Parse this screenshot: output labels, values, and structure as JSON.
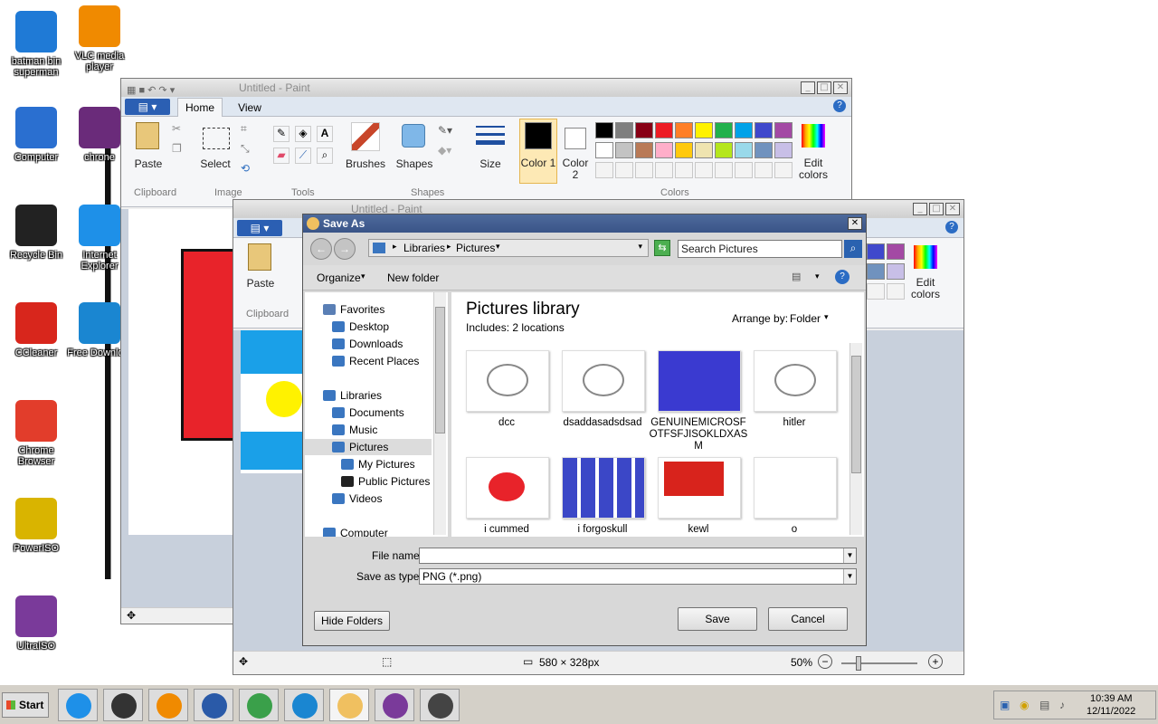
{
  "desktop": {
    "icons": [
      {
        "label": "batman bin superman",
        "color": "#1f7ad6"
      },
      {
        "label": "VLC media player",
        "color": "#f08a00"
      },
      {
        "label": "Computer",
        "color": "#2a6fd0"
      },
      {
        "label": "chrone",
        "color": "#6a2b7a"
      },
      {
        "label": "Recycle Bin",
        "color": "#222222"
      },
      {
        "label": "Internet Explorer",
        "color": "#1e90e8"
      },
      {
        "label": "CCleaner",
        "color": "#d8261c"
      },
      {
        "label": "Free Downlo...",
        "color": "#1a86d1"
      },
      {
        "label": "Chrome Browser",
        "color": "#e23d2b"
      },
      {
        "label": "PowerISO",
        "color": "#d9b400"
      },
      {
        "label": "UltraISO",
        "color": "#7a3a9a"
      }
    ]
  },
  "paint_back": {
    "title": "Untitled - Paint",
    "tabs": [
      "Home",
      "View"
    ],
    "clipboard": {
      "paste": "Paste",
      "group": "Clipboard"
    },
    "image": {
      "select": "Select",
      "group": "Image"
    },
    "tools_group": "Tools",
    "brushes": "Brushes",
    "shapes": {
      "label": "Shapes",
      "group": "Shapes"
    },
    "size": "Size",
    "color1": "Color 1",
    "color2": "Color 2",
    "colors_group": "Colors",
    "edit_colors": "Edit colors",
    "palette_row1": [
      "#000000",
      "#7f7f7f",
      "#880015",
      "#ed1c24",
      "#ff7f27",
      "#fff200",
      "#22b14c",
      "#00a2e8",
      "#3f48cc",
      "#a349a4"
    ],
    "palette_row2": [
      "#ffffff",
      "#c3c3c3",
      "#b97a57",
      "#ffaec9",
      "#ffc90e",
      "#efe4b0",
      "#b5e61d",
      "#99d9ea",
      "#7092be",
      "#c8bfe7"
    ]
  },
  "paint_front": {
    "title": "Untitled - Paint",
    "paste": "Paste",
    "clipboard_group": "Clipboard",
    "edit_colors": "Edit colors",
    "status": {
      "dimensions": "580 × 328px",
      "zoom": "50%"
    }
  },
  "dialog": {
    "title": "Save As",
    "breadcrumb": [
      "Libraries",
      "Pictures"
    ],
    "search_placeholder": "Search Pictures",
    "toolbar": {
      "organize": "Organize",
      "new_folder": "New folder"
    },
    "nav": {
      "favorites": "Favorites",
      "favorites_items": [
        "Desktop",
        "Downloads",
        "Recent Places"
      ],
      "libraries": "Libraries",
      "libraries_items": [
        "Documents",
        "Music",
        "Pictures"
      ],
      "pictures_items": [
        "My Pictures",
        "Public Pictures"
      ],
      "videos": "Videos",
      "computer": "Computer"
    },
    "library_title": "Pictures library",
    "includes": "Includes: 2 locations",
    "arrange_label": "Arrange by:",
    "arrange_value": "Folder",
    "files": [
      "dcc",
      "dsaddasadsdsad",
      "GENUINEMICROSFOTFSFJISOKLDXASM",
      "hitler",
      "i cummed",
      "i forgoskull",
      "kewl",
      "o"
    ],
    "file_name_label": "File name:",
    "file_name_value": "",
    "save_type_label": "Save as type:",
    "save_type_value": "PNG (*.png)",
    "hide_folders": "Hide Folders",
    "save": "Save",
    "cancel": "Cancel"
  },
  "taskbar": {
    "start": "Start",
    "clock_time": "10:39 AM",
    "clock_date": "12/11/2022"
  }
}
